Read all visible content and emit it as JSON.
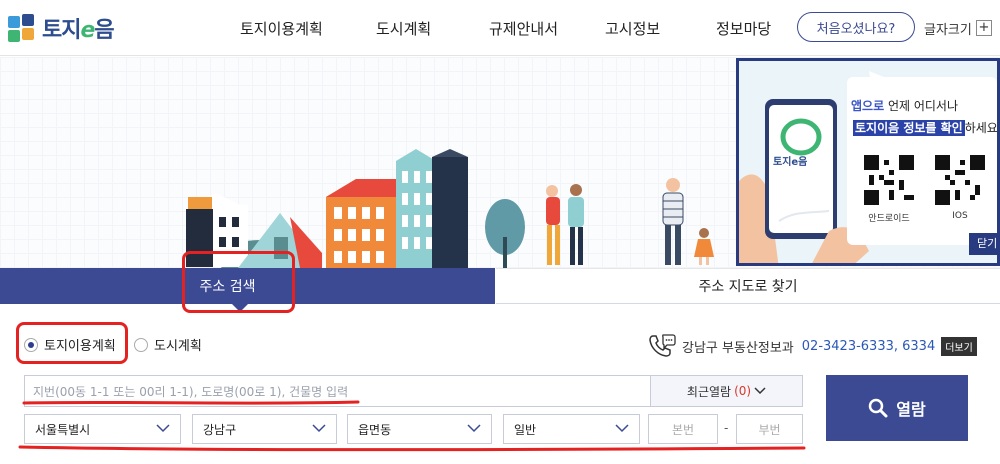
{
  "header": {
    "logo_text_a": "토지",
    "logo_text_e": "e",
    "logo_text_b": "음",
    "nav": [
      "토지이용계획",
      "도시계획",
      "규제안내서",
      "고시정보",
      "정보마당"
    ],
    "first_visit": "처음오셨나요?",
    "font_size": "글자크기",
    "plus": "+"
  },
  "promo": {
    "line1_highlight": "앱으로",
    "line1_rest": " 언제 어디서나",
    "line2_highlight": "토지이음 정보를 확인",
    "line2_rest": "하세요",
    "phone_logo": "토지e음",
    "android": "안드로이드",
    "ios": "IOS",
    "close": "닫기"
  },
  "tabs": {
    "address": "주소 검색",
    "map": "주소 지도로 찾기"
  },
  "options": {
    "radio1": "토지이용계획",
    "radio2": "도시계획"
  },
  "contact": {
    "office": "강남구 부동산정보과",
    "tel": "02-3423-6333, 6334",
    "more": "더보기"
  },
  "search": {
    "placeholder": "지번(00동 1-1 또는 00리 1-1), 도로명(00로 1), 건물명 입력",
    "recent_label": "최근열람",
    "recent_count": "(0)",
    "open_button": "열람",
    "sido": "서울특별시",
    "sigungu": "강남구",
    "eupmyeondong": "읍면동",
    "type": "일반",
    "bonbeon": "본번",
    "dash": "-",
    "bubeon": "부번"
  },
  "colors": {
    "primary": "#3c4a94",
    "accent_red": "#e52222",
    "link_blue": "#2b58b8"
  }
}
